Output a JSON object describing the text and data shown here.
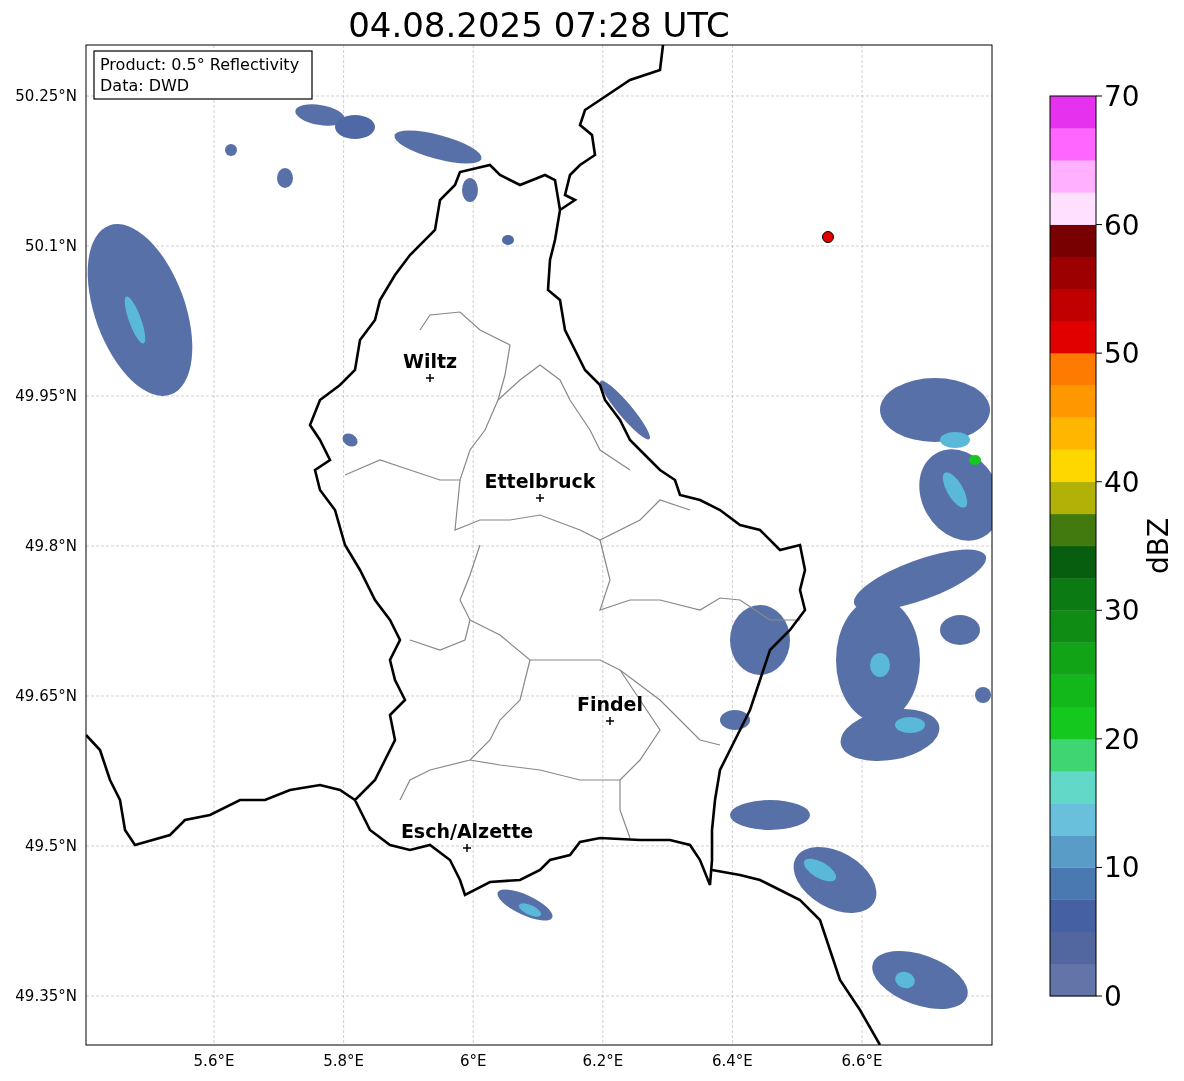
{
  "title": "04.08.2025 07:28 UTC",
  "legend": [
    "Product: 0.5° Reflectivity",
    "Data: DWD"
  ],
  "x_ticks": [
    "5.6°E",
    "5.8°E",
    "6°E",
    "6.2°E",
    "6.4°E",
    "6.6°E"
  ],
  "y_ticks": [
    "50.25°N",
    "50.1°N",
    "49.95°N",
    "49.8°N",
    "49.65°N",
    "49.5°N",
    "49.35°N"
  ],
  "cities": [
    {
      "name": "Wiltz"
    },
    {
      "name": "Ettelbruck"
    },
    {
      "name": "Findel"
    },
    {
      "name": "Esch/Alzette"
    }
  ],
  "colorbar": {
    "label": "dBZ",
    "ticks": [
      "70",
      "60",
      "50",
      "40",
      "30",
      "20",
      "10",
      "0"
    ],
    "bins": [
      {
        "color": "#6374a8"
      },
      {
        "color": "#52679f"
      },
      {
        "color": "#4560a3"
      },
      {
        "color": "#4a78b0"
      },
      {
        "color": "#5a9cc8"
      },
      {
        "color": "#68c0dc"
      },
      {
        "color": "#62d8c8"
      },
      {
        "color": "#3dd672"
      },
      {
        "color": "#14c81e"
      },
      {
        "color": "#12b81a"
      },
      {
        "color": "#10a416"
      },
      {
        "color": "#0e8c14"
      },
      {
        "color": "#0b7a12"
      },
      {
        "color": "#075e0e"
      },
      {
        "color": "#437a10"
      },
      {
        "color": "#b1b108"
      },
      {
        "color": "#ffd700"
      },
      {
        "color": "#ffb600"
      },
      {
        "color": "#ff9800"
      },
      {
        "color": "#ff7a00"
      },
      {
        "color": "#e00000"
      },
      {
        "color": "#c00000"
      },
      {
        "color": "#9c0000"
      },
      {
        "color": "#780000"
      },
      {
        "color": "#ffe0ff"
      },
      {
        "color": "#ffb0ff"
      },
      {
        "color": "#ff66ff"
      },
      {
        "color": "#e632ee"
      }
    ]
  }
}
